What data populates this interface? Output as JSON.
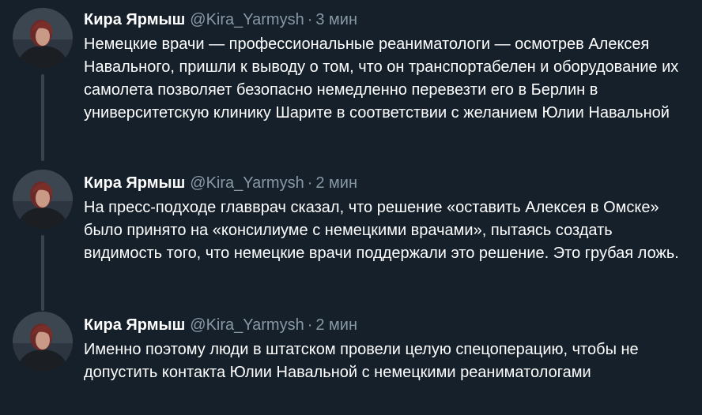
{
  "tweets": [
    {
      "name": "Кира Ярмыш",
      "handle": "@Kira_Yarmysh",
      "separator": "·",
      "time": "3 мин",
      "text": "Немецкие врачи — профессиональные реаниматологи — осмотрев Алексея Навального, пришли к выводу о том, что он транспортабелен и оборудование их самолета позволяет безопасно немедленно перевезти его в Берлин в университетскую клинику Шарите в соответствии с желанием Юлии Навальной"
    },
    {
      "name": "Кира Ярмыш",
      "handle": "@Kira_Yarmysh",
      "separator": "·",
      "time": "2 мин",
      "text": "На пресс-подходе главврач сказал, что решение «оставить Алексея в Омске» было принято на «консилиуме с немецкими врачами», пытаясь создать видимость того, что немецкие врачи поддержали это решение. Это грубая ложь."
    },
    {
      "name": "Кира Ярмыш",
      "handle": "@Kira_Yarmysh",
      "separator": "·",
      "time": "2 мин",
      "text": "Именно поэтому люди в штатском провели целую спецоперацию, чтобы не допустить контакта Юлии Навальной с немецкими реаниматологами"
    }
  ],
  "colors": {
    "background": "#15202b",
    "text": "#ffffff",
    "secondary": "#8899a6",
    "thread_line": "#38444d"
  },
  "icons": {
    "avatar": "profile-photo-avatar"
  }
}
